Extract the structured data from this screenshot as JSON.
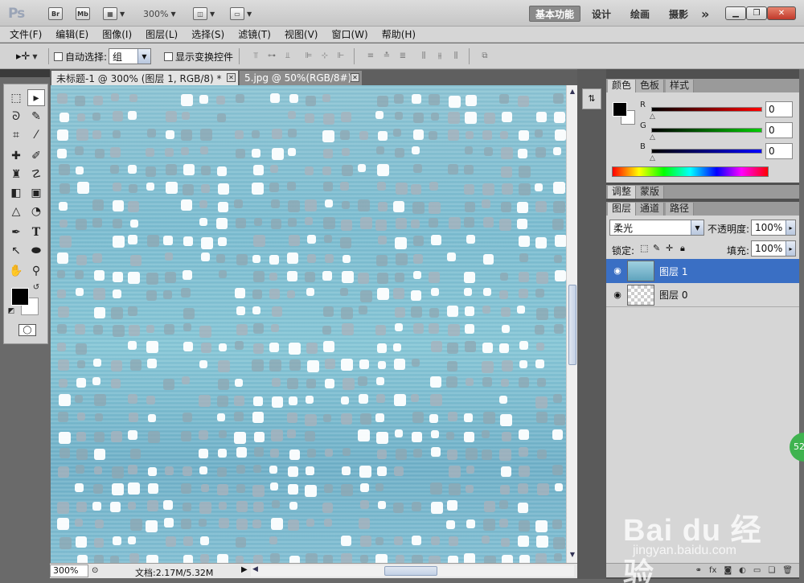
{
  "app": {
    "logo": "Ps"
  },
  "titlebar": {
    "bridge": "Br",
    "minibridge": "Mb",
    "zoom": "300%",
    "workspaces": [
      "基本功能",
      "设计",
      "绘画",
      "摄影"
    ],
    "more": "»"
  },
  "menu": [
    "文件(F)",
    "编辑(E)",
    "图像(I)",
    "图层(L)",
    "选择(S)",
    "滤镜(T)",
    "视图(V)",
    "窗口(W)",
    "帮助(H)"
  ],
  "options": {
    "auto_select_label": "自动选择:",
    "auto_select_value": "组",
    "show_transform_label": "显示变换控件"
  },
  "documents": [
    {
      "title": "未标题-1 @ 300% (图层 1, RGB/8) *",
      "active": true
    },
    {
      "title": "5.jpg @ 50%(RGB/8#)",
      "active": false
    }
  ],
  "status": {
    "zoom": "300%",
    "doc_info": "文档:2.17M/5.32M"
  },
  "color_panel": {
    "tabs": [
      "颜色",
      "色板",
      "样式"
    ],
    "channels": [
      {
        "label": "R",
        "value": "0",
        "color": "#ff0000"
      },
      {
        "label": "G",
        "value": "0",
        "color": "#00cc00"
      },
      {
        "label": "B",
        "value": "0",
        "color": "#0000ff"
      }
    ]
  },
  "adjust_panel": {
    "tabs": [
      "调整",
      "蒙版"
    ]
  },
  "layers_panel": {
    "tabs": [
      "图层",
      "通道",
      "路径"
    ],
    "blend_mode": "柔光",
    "opacity_label": "不透明度:",
    "opacity": "100%",
    "lock_label": "锁定:",
    "fill_label": "填充:",
    "fill": "100%",
    "layers": [
      {
        "name": "图层 1",
        "selected": true
      },
      {
        "name": "图层 0",
        "selected": false
      }
    ]
  },
  "badge": "52",
  "watermark": {
    "main": "Bai du 经验",
    "sub": "jingyan.baidu.com"
  }
}
